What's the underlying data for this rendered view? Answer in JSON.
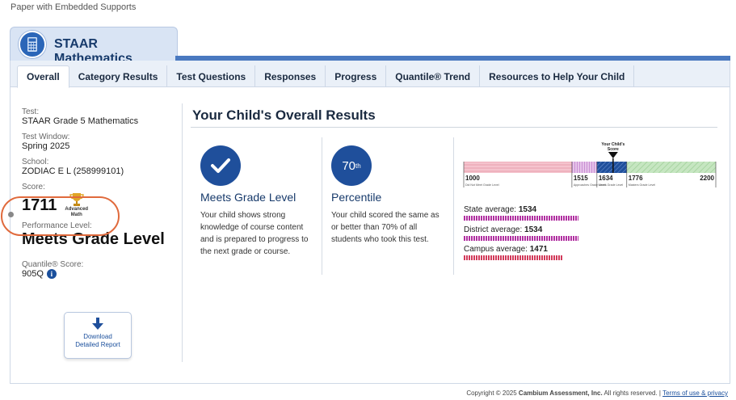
{
  "header": {
    "subtitle": "Paper with Embedded Supports"
  },
  "app": {
    "title": "STAAR Mathematics",
    "icon": "calculator-icon"
  },
  "tabs": [
    {
      "label": "Overall",
      "active": true
    },
    {
      "label": "Category Results"
    },
    {
      "label": "Test Questions"
    },
    {
      "label": "Responses"
    },
    {
      "label": "Progress"
    },
    {
      "label": "Quantile® Trend"
    },
    {
      "label": "Resources to Help Your Child"
    }
  ],
  "sidebar": {
    "test_label": "Test:",
    "test_value": "STAAR Grade 5 Mathematics",
    "window_label": "Test Window:",
    "window_value": "Spring 2025",
    "school_label": "School:",
    "school_value": "ZODIAC E L (258999101)",
    "score_label": "Score:",
    "score_value": "1711",
    "trophy_caption_line1": "Advanced",
    "trophy_caption_line2": "Math",
    "performance_label": "Performance Level:",
    "performance_value": "Meets Grade Level",
    "quantile_label": "Quantile® Score:",
    "quantile_value": "905Q",
    "info_icon": "i",
    "download_line1": "Download",
    "download_line2": "Detailed Report"
  },
  "results": {
    "title": "Your Child's Overall Results",
    "card1": {
      "heading": "Meets Grade Level",
      "text": "Your child shows strong knowledge of course content and is prepared to progress to the next grade or course."
    },
    "card2": {
      "pct_num": "70",
      "pct_suffix": "th",
      "heading": "Percentile",
      "text": "Your child scored the same as or better than 70% of all students who took this test."
    }
  },
  "scale": {
    "marker_label_line1": "Your Child's",
    "marker_label_line2": "Score",
    "min": 1000,
    "max": 2200,
    "score": 1711,
    "cuts": [
      "1515",
      "1634",
      "1776"
    ],
    "min_label": "1000",
    "max_label": "2200",
    "band_labels": [
      "Did Not Meet Grade Level",
      "Approaches Grade Level",
      "Meets Grade Level",
      "Masters Grade Level"
    ],
    "colors": {
      "did_not_meet": "#f2b6c1",
      "approaches": "#d9b0e0",
      "meets": "#1f4f9b",
      "masters": "#b9dfb4"
    }
  },
  "averages": [
    {
      "label": "State average:",
      "value": "1534",
      "color": "#b02fa0",
      "fraction": 0.45
    },
    {
      "label": "District average:",
      "value": "1534",
      "color": "#b02fa0",
      "fraction": 0.45
    },
    {
      "label": "Campus average:",
      "value": "1471",
      "color": "#d23a5a",
      "fraction": 0.39
    }
  ],
  "footer": {
    "copyright_prefix": "Copyright © 2025 ",
    "company": "Cambium Assessment, Inc.",
    "rights": " All rights reserved.  |  ",
    "link": "Terms of use & privacy"
  }
}
